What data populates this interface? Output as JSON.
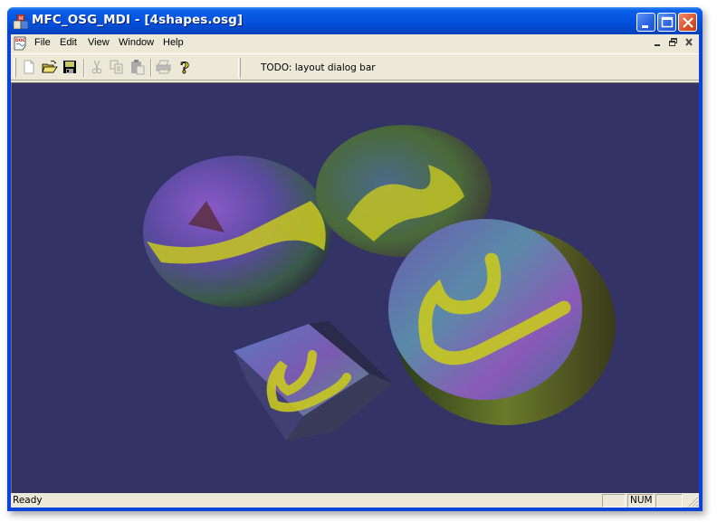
{
  "window": {
    "title": "MFC_OSG_MDI - [4shapes.osg]",
    "app_icon": "mfc-app-icon",
    "controls": [
      "minimize",
      "maximize",
      "close"
    ]
  },
  "menubar": {
    "doc_icon": "document-icon",
    "items": [
      {
        "label": "File"
      },
      {
        "label": "Edit"
      },
      {
        "label": "View"
      },
      {
        "label": "Window"
      },
      {
        "label": "Help"
      }
    ],
    "mdi_controls": [
      "minimize",
      "restore",
      "close"
    ]
  },
  "toolbar": {
    "buttons": [
      {
        "name": "new",
        "icon": "new-file-icon",
        "enabled": true
      },
      {
        "name": "open",
        "icon": "open-folder-icon",
        "enabled": true
      },
      {
        "name": "save",
        "icon": "save-disk-icon",
        "enabled": true
      },
      {
        "name": "cut",
        "icon": "scissors-icon",
        "enabled": false
      },
      {
        "name": "copy",
        "icon": "copy-icon",
        "enabled": false
      },
      {
        "name": "paste",
        "icon": "paste-icon",
        "enabled": false
      },
      {
        "name": "print",
        "icon": "printer-icon",
        "enabled": false
      },
      {
        "name": "about",
        "icon": "help-question-icon",
        "enabled": true
      }
    ],
    "dialog_bar_text": "TODO: layout dialog bar"
  },
  "viewport": {
    "background_color": "#333366",
    "scene_objects": [
      "sphere",
      "cone",
      "cylinder",
      "box"
    ],
    "texture_colors": [
      "#c8c820",
      "#6a4aa8",
      "#4a8a5a",
      "#4a6ac8",
      "#a84a8a",
      "#5a2a3a"
    ]
  },
  "statusbar": {
    "text": "Ready",
    "panes": [
      "",
      "NUM",
      ""
    ]
  }
}
